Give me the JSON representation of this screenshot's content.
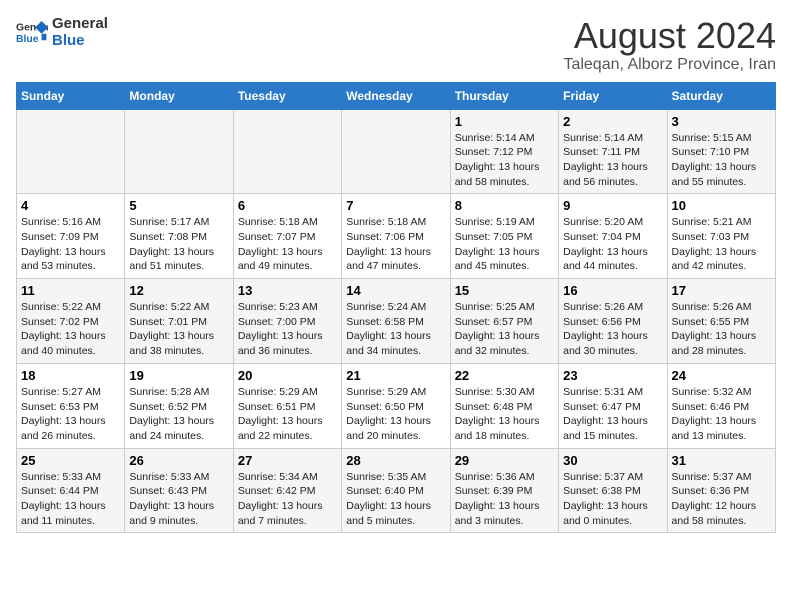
{
  "header": {
    "logo_line1": "General",
    "logo_line2": "Blue",
    "main_title": "August 2024",
    "subtitle": "Taleqan, Alborz Province, Iran"
  },
  "weekdays": [
    "Sunday",
    "Monday",
    "Tuesday",
    "Wednesday",
    "Thursday",
    "Friday",
    "Saturday"
  ],
  "weeks": [
    [
      {
        "day": "",
        "info": ""
      },
      {
        "day": "",
        "info": ""
      },
      {
        "day": "",
        "info": ""
      },
      {
        "day": "",
        "info": ""
      },
      {
        "day": "1",
        "info": "Sunrise: 5:14 AM\nSunset: 7:12 PM\nDaylight: 13 hours\nand 58 minutes."
      },
      {
        "day": "2",
        "info": "Sunrise: 5:14 AM\nSunset: 7:11 PM\nDaylight: 13 hours\nand 56 minutes."
      },
      {
        "day": "3",
        "info": "Sunrise: 5:15 AM\nSunset: 7:10 PM\nDaylight: 13 hours\nand 55 minutes."
      }
    ],
    [
      {
        "day": "4",
        "info": "Sunrise: 5:16 AM\nSunset: 7:09 PM\nDaylight: 13 hours\nand 53 minutes."
      },
      {
        "day": "5",
        "info": "Sunrise: 5:17 AM\nSunset: 7:08 PM\nDaylight: 13 hours\nand 51 minutes."
      },
      {
        "day": "6",
        "info": "Sunrise: 5:18 AM\nSunset: 7:07 PM\nDaylight: 13 hours\nand 49 minutes."
      },
      {
        "day": "7",
        "info": "Sunrise: 5:18 AM\nSunset: 7:06 PM\nDaylight: 13 hours\nand 47 minutes."
      },
      {
        "day": "8",
        "info": "Sunrise: 5:19 AM\nSunset: 7:05 PM\nDaylight: 13 hours\nand 45 minutes."
      },
      {
        "day": "9",
        "info": "Sunrise: 5:20 AM\nSunset: 7:04 PM\nDaylight: 13 hours\nand 44 minutes."
      },
      {
        "day": "10",
        "info": "Sunrise: 5:21 AM\nSunset: 7:03 PM\nDaylight: 13 hours\nand 42 minutes."
      }
    ],
    [
      {
        "day": "11",
        "info": "Sunrise: 5:22 AM\nSunset: 7:02 PM\nDaylight: 13 hours\nand 40 minutes."
      },
      {
        "day": "12",
        "info": "Sunrise: 5:22 AM\nSunset: 7:01 PM\nDaylight: 13 hours\nand 38 minutes."
      },
      {
        "day": "13",
        "info": "Sunrise: 5:23 AM\nSunset: 7:00 PM\nDaylight: 13 hours\nand 36 minutes."
      },
      {
        "day": "14",
        "info": "Sunrise: 5:24 AM\nSunset: 6:58 PM\nDaylight: 13 hours\nand 34 minutes."
      },
      {
        "day": "15",
        "info": "Sunrise: 5:25 AM\nSunset: 6:57 PM\nDaylight: 13 hours\nand 32 minutes."
      },
      {
        "day": "16",
        "info": "Sunrise: 5:26 AM\nSunset: 6:56 PM\nDaylight: 13 hours\nand 30 minutes."
      },
      {
        "day": "17",
        "info": "Sunrise: 5:26 AM\nSunset: 6:55 PM\nDaylight: 13 hours\nand 28 minutes."
      }
    ],
    [
      {
        "day": "18",
        "info": "Sunrise: 5:27 AM\nSunset: 6:53 PM\nDaylight: 13 hours\nand 26 minutes."
      },
      {
        "day": "19",
        "info": "Sunrise: 5:28 AM\nSunset: 6:52 PM\nDaylight: 13 hours\nand 24 minutes."
      },
      {
        "day": "20",
        "info": "Sunrise: 5:29 AM\nSunset: 6:51 PM\nDaylight: 13 hours\nand 22 minutes."
      },
      {
        "day": "21",
        "info": "Sunrise: 5:29 AM\nSunset: 6:50 PM\nDaylight: 13 hours\nand 20 minutes."
      },
      {
        "day": "22",
        "info": "Sunrise: 5:30 AM\nSunset: 6:48 PM\nDaylight: 13 hours\nand 18 minutes."
      },
      {
        "day": "23",
        "info": "Sunrise: 5:31 AM\nSunset: 6:47 PM\nDaylight: 13 hours\nand 15 minutes."
      },
      {
        "day": "24",
        "info": "Sunrise: 5:32 AM\nSunset: 6:46 PM\nDaylight: 13 hours\nand 13 minutes."
      }
    ],
    [
      {
        "day": "25",
        "info": "Sunrise: 5:33 AM\nSunset: 6:44 PM\nDaylight: 13 hours\nand 11 minutes."
      },
      {
        "day": "26",
        "info": "Sunrise: 5:33 AM\nSunset: 6:43 PM\nDaylight: 13 hours\nand 9 minutes."
      },
      {
        "day": "27",
        "info": "Sunrise: 5:34 AM\nSunset: 6:42 PM\nDaylight: 13 hours\nand 7 minutes."
      },
      {
        "day": "28",
        "info": "Sunrise: 5:35 AM\nSunset: 6:40 PM\nDaylight: 13 hours\nand 5 minutes."
      },
      {
        "day": "29",
        "info": "Sunrise: 5:36 AM\nSunset: 6:39 PM\nDaylight: 13 hours\nand 3 minutes."
      },
      {
        "day": "30",
        "info": "Sunrise: 5:37 AM\nSunset: 6:38 PM\nDaylight: 13 hours\nand 0 minutes."
      },
      {
        "day": "31",
        "info": "Sunrise: 5:37 AM\nSunset: 6:36 PM\nDaylight: 12 hours\nand 58 minutes."
      }
    ]
  ]
}
